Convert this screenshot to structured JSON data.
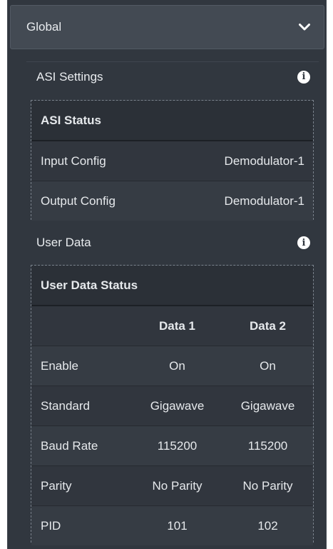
{
  "global": {
    "label": "Global",
    "icon": "chevron-down-icon"
  },
  "asi": {
    "section_label": "ASI Settings",
    "info_icon": "info-icon",
    "status_title": "ASI Status",
    "rows": [
      {
        "label": "Input Config",
        "value": "Demodulator-1"
      },
      {
        "label": "Output Config",
        "value": "Demodulator-1"
      }
    ]
  },
  "user_data": {
    "section_label": "User Data",
    "info_icon": "info-icon",
    "status_title": "User Data Status",
    "columns": [
      "Data 1",
      "Data 2"
    ],
    "rows": [
      {
        "label": "Enable",
        "values": [
          "On",
          "On"
        ]
      },
      {
        "label": "Standard",
        "values": [
          "Gigawave",
          "Gigawave"
        ]
      },
      {
        "label": "Baud Rate",
        "values": [
          "115200",
          "115200"
        ]
      },
      {
        "label": "Parity",
        "values": [
          "No Parity",
          "No Parity"
        ]
      },
      {
        "label": "PID",
        "values": [
          "101",
          "102"
        ]
      }
    ]
  }
}
